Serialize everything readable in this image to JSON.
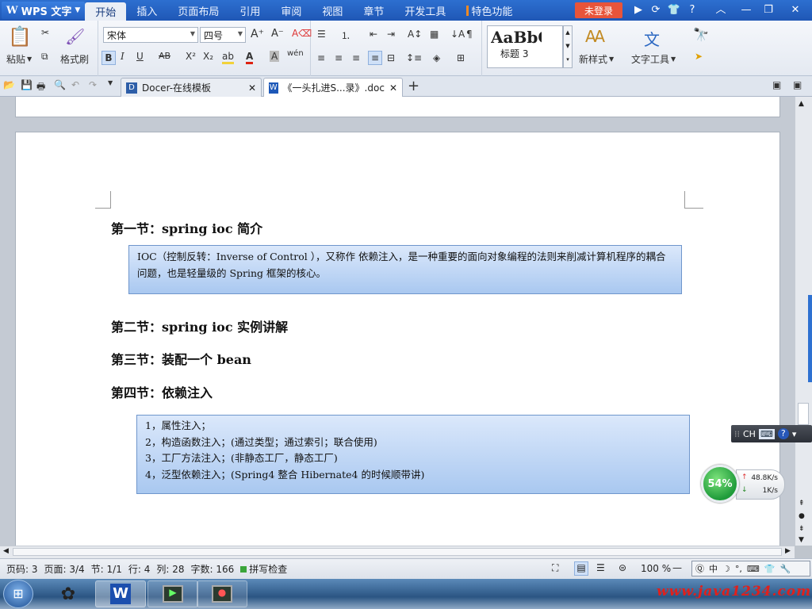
{
  "app": {
    "name": "WPS 文字"
  },
  "menu": [
    "开始",
    "插入",
    "页面布局",
    "引用",
    "审阅",
    "视图",
    "章节",
    "开发工具",
    "特色功能"
  ],
  "login": "未登录",
  "ribbon": {
    "paste": "粘贴",
    "format_painter": "格式刷",
    "font_name": "宋体",
    "font_size": "四号",
    "style_preview": "AaBbC",
    "style_name": "标题 3",
    "new_style": "新样式",
    "text_tools": "文字工具",
    "font_buttons": [
      "B",
      "I",
      "U",
      "AB",
      "X²",
      "X₂"
    ]
  },
  "tabs": [
    {
      "label": "Docer-在线模板"
    },
    {
      "label": "《一头扎进S...录》.doc"
    }
  ],
  "document": {
    "h1": "第一节：spring ioc 简介",
    "box1": "IOC（控制反转：Inverse of Control ），又称作 依赖注入，是一种重要的面向对象编程的法则来削减计算机程序的耦合问题，也是轻量级的 Spring 框架的核心。",
    "h2": "第二节：spring ioc 实例讲解",
    "h3": "第三节：装配一个 bean",
    "h4": "第四节：依赖注入",
    "box2": [
      "1，属性注入；",
      "2，构造函数注入；(通过类型；通过索引；联合使用)",
      "3，工厂方法注入；(非静态工厂，静态工厂)",
      "4，泛型依赖注入；(Spring4 整合 Hibernate4 的时候顺带讲)"
    ]
  },
  "status": {
    "page_num": "页码: 3",
    "page": "页面: 3/4",
    "section": "节: 1/1",
    "row": "行: 4",
    "col": "列: 28",
    "words": "字数: 166",
    "spell": "拼写检查",
    "zoom": "100 %"
  },
  "ime": {
    "lang": "CH"
  },
  "netmon": {
    "percent": "54%",
    "up": "48.8K/s",
    "down": "1K/s"
  },
  "watermark": "www.java1234.com",
  "colors": {
    "titlebar": "#2361c4",
    "login": "#e8543a",
    "box_border": "#6f96cc"
  }
}
